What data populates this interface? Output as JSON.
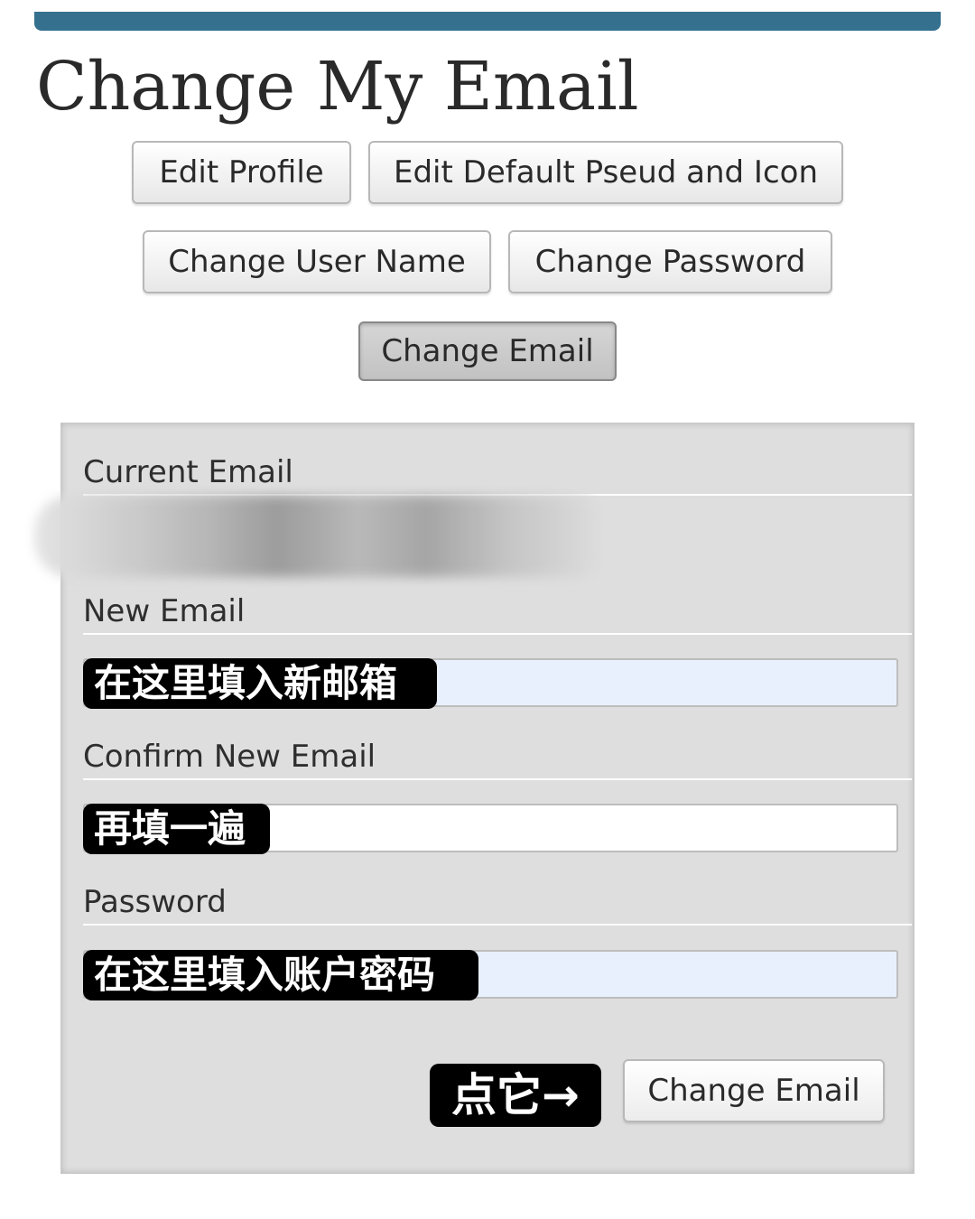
{
  "page": {
    "title": "Change My Email",
    "accent_color": "#35718f"
  },
  "nav": {
    "edit_profile": "Edit Profile",
    "edit_pseud_icon": "Edit Default Pseud and Icon",
    "change_user_name": "Change User Name",
    "change_password": "Change Password",
    "change_email": "Change Email",
    "current_item": "Change Email"
  },
  "form": {
    "current_email_label": "Current Email",
    "current_email_value": "",
    "new_email_label": "New Email",
    "new_email_value": "",
    "confirm_email_label": "Confirm New Email",
    "confirm_email_value": "",
    "password_label": "Password",
    "password_value": "",
    "submit_label": "Change Email"
  },
  "annotations": {
    "new_email_hint": "在这里填入新邮箱",
    "confirm_email_hint": "再填一遍",
    "password_hint": "在这里填入账户密码",
    "submit_hint": "点它→"
  }
}
